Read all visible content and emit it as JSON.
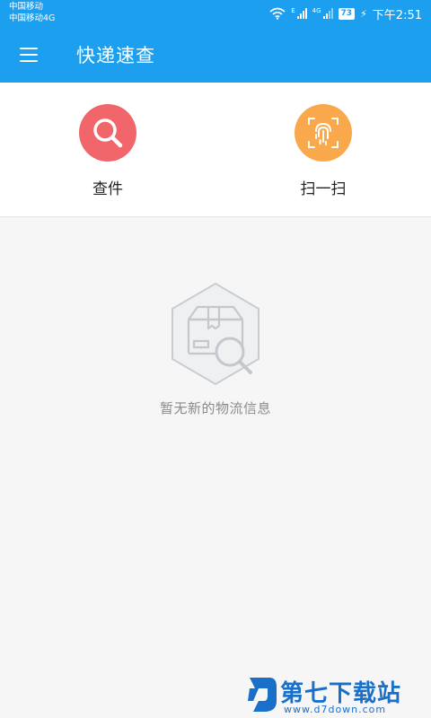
{
  "status_bar": {
    "carrier_1": "中国移动",
    "carrier_2": "中国移动4G",
    "network_1": "E",
    "network_2": "4G",
    "battery": "73",
    "time": "下午2:51"
  },
  "app_bar": {
    "title": "快递速查"
  },
  "actions": {
    "query_label": "查件",
    "scan_label": "扫一扫",
    "query_color": "#f0666a",
    "scan_color": "#f9a94b"
  },
  "empty_state": {
    "message": "暂无新的物流信息"
  },
  "watermark": {
    "name": "第七下载站",
    "url": "www.d7down.com"
  },
  "colors": {
    "primary": "#1d9ff0",
    "background": "#f6f6f7"
  }
}
